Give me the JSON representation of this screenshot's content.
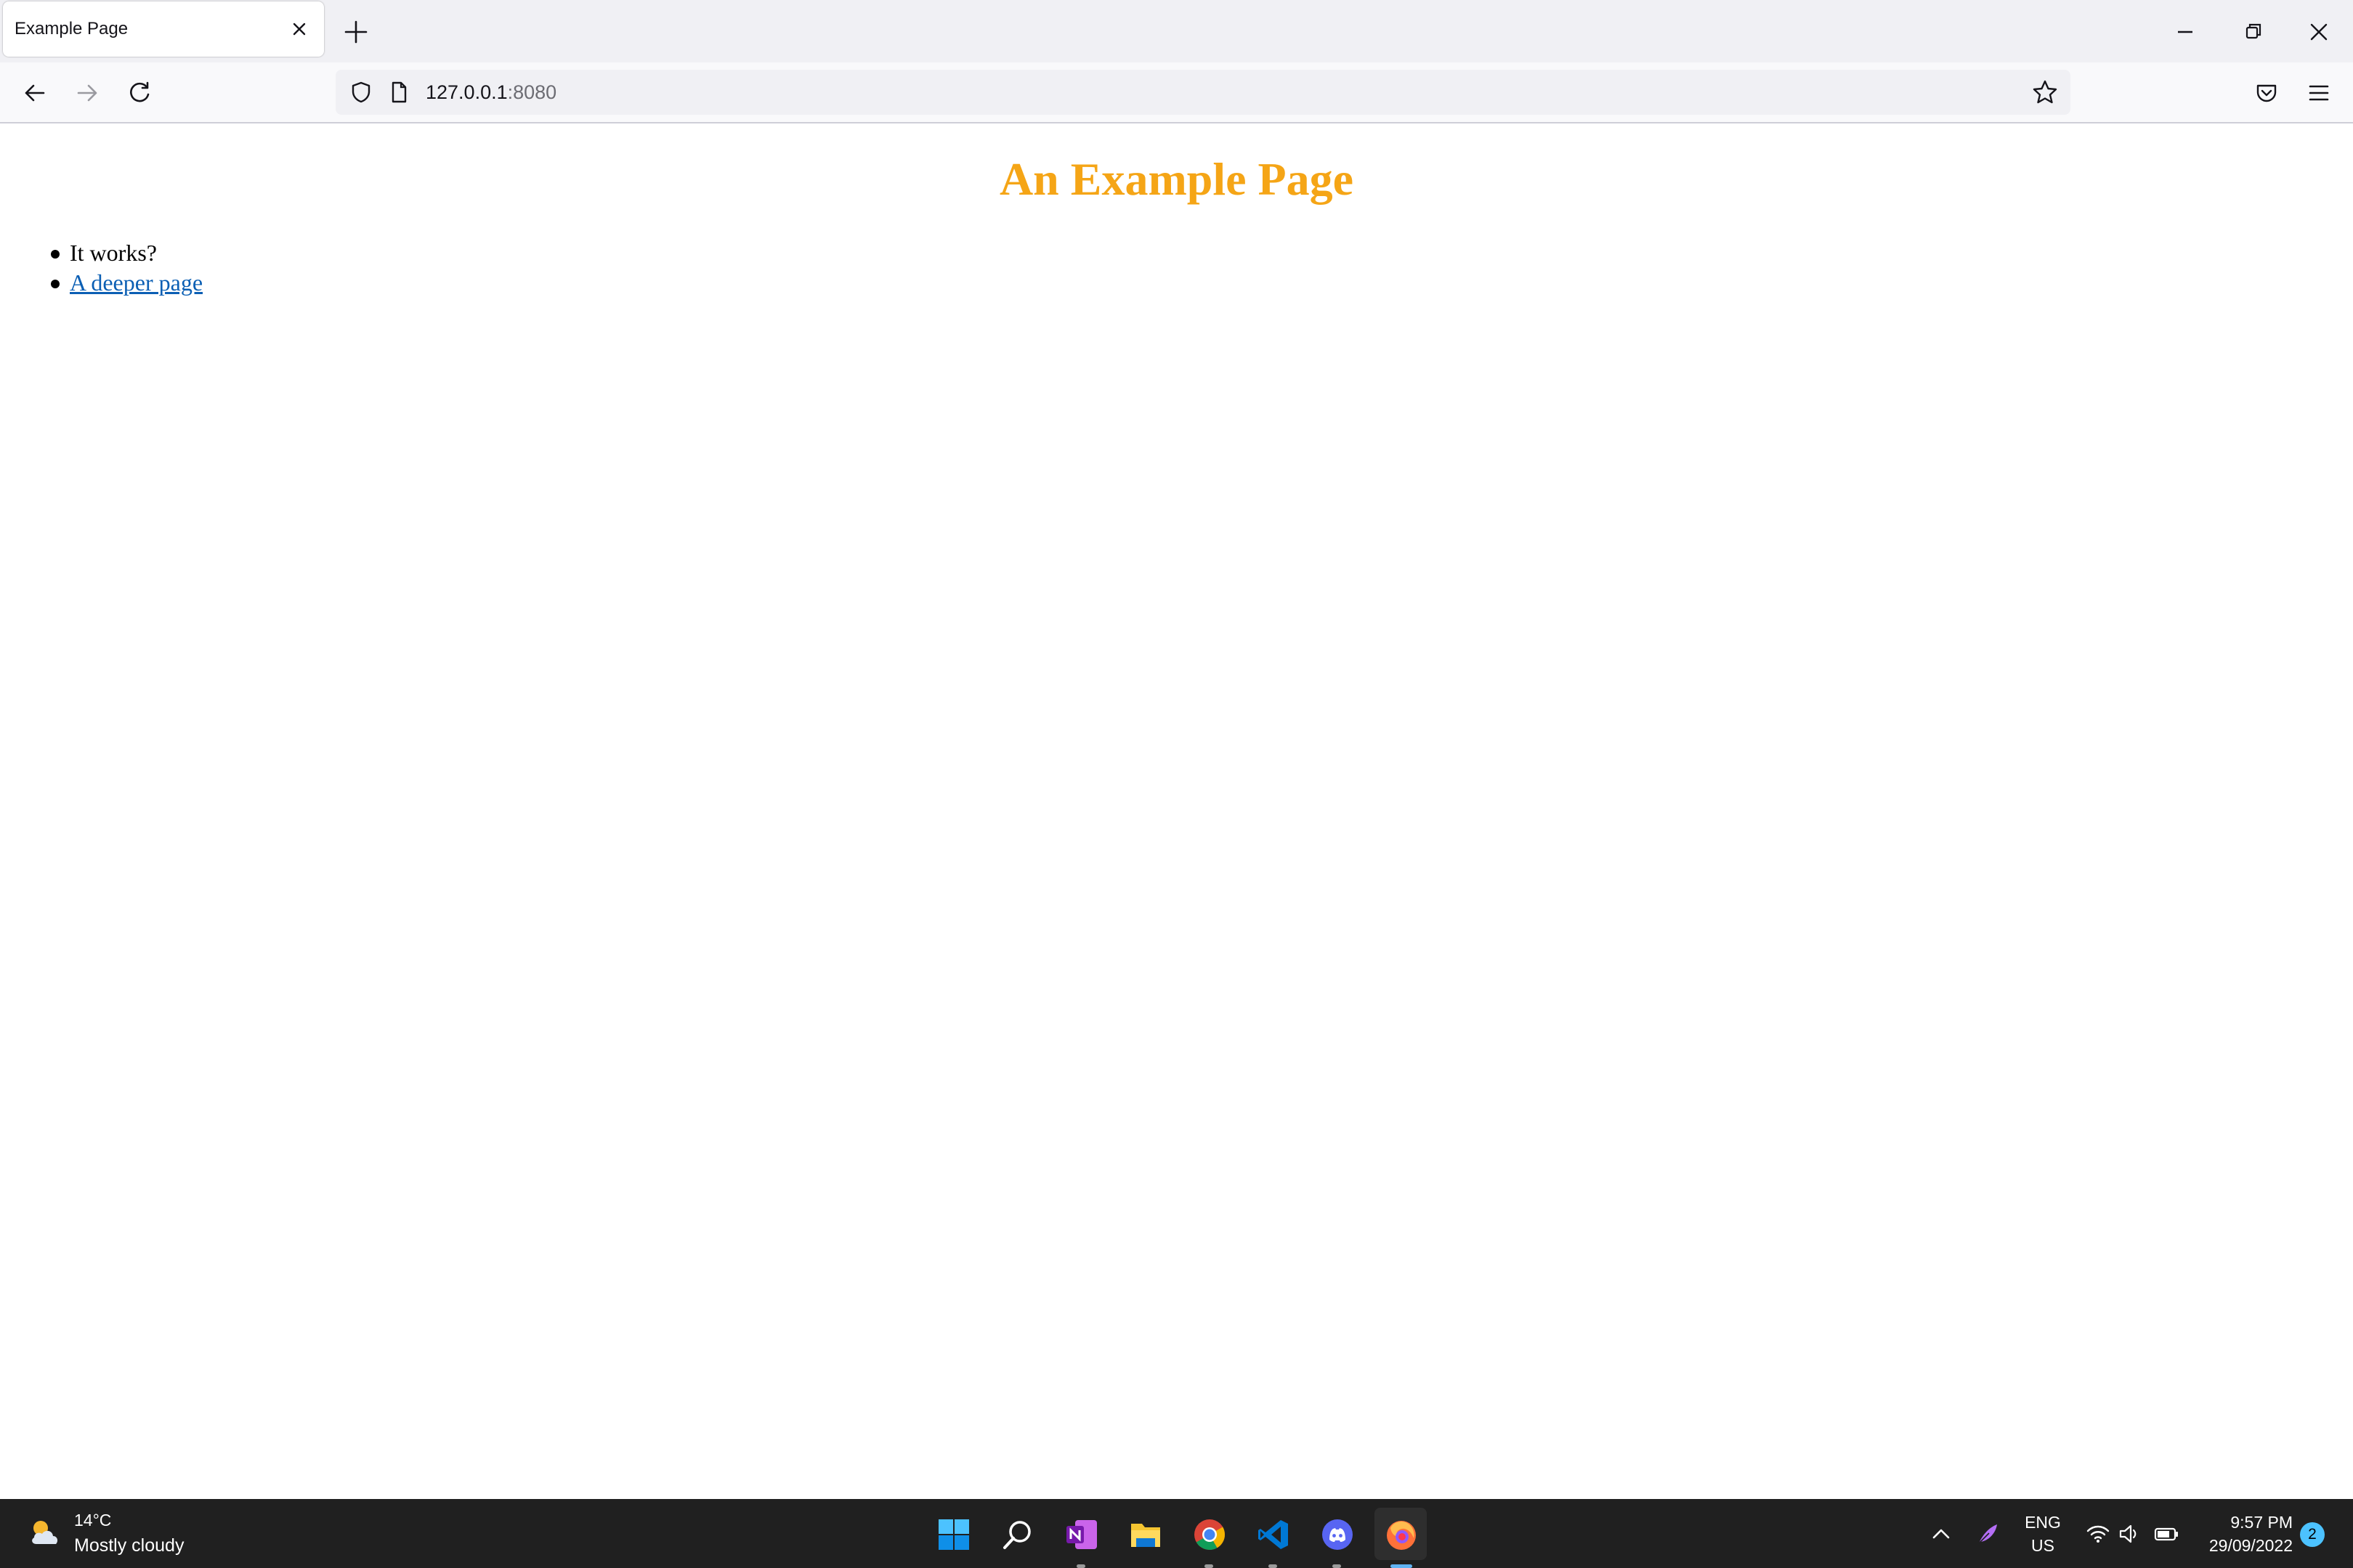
{
  "browser": {
    "tab": {
      "title": "Example Page"
    },
    "url": {
      "host": "127.0.0.1",
      "port": ":8080"
    }
  },
  "page": {
    "heading": "An Example Page",
    "heading_color": "#f5a516",
    "list": [
      {
        "text": "It works?"
      },
      {
        "text": "A deeper page"
      }
    ],
    "link_color": "#0b5fb4"
  },
  "taskbar": {
    "weather": {
      "temp": "14°C",
      "desc": "Mostly cloudy",
      "icon": "partly-cloudy-icon"
    },
    "apps": [
      "start-icon",
      "search-icon",
      "onenote-icon",
      "file-explorer-icon",
      "chrome-icon",
      "vscode-icon",
      "discord-icon",
      "firefox-icon"
    ],
    "tray": {
      "lang_line1": "ENG",
      "lang_line2": "US",
      "time": "9:57 PM",
      "date": "29/09/2022",
      "notifications": "2"
    }
  }
}
